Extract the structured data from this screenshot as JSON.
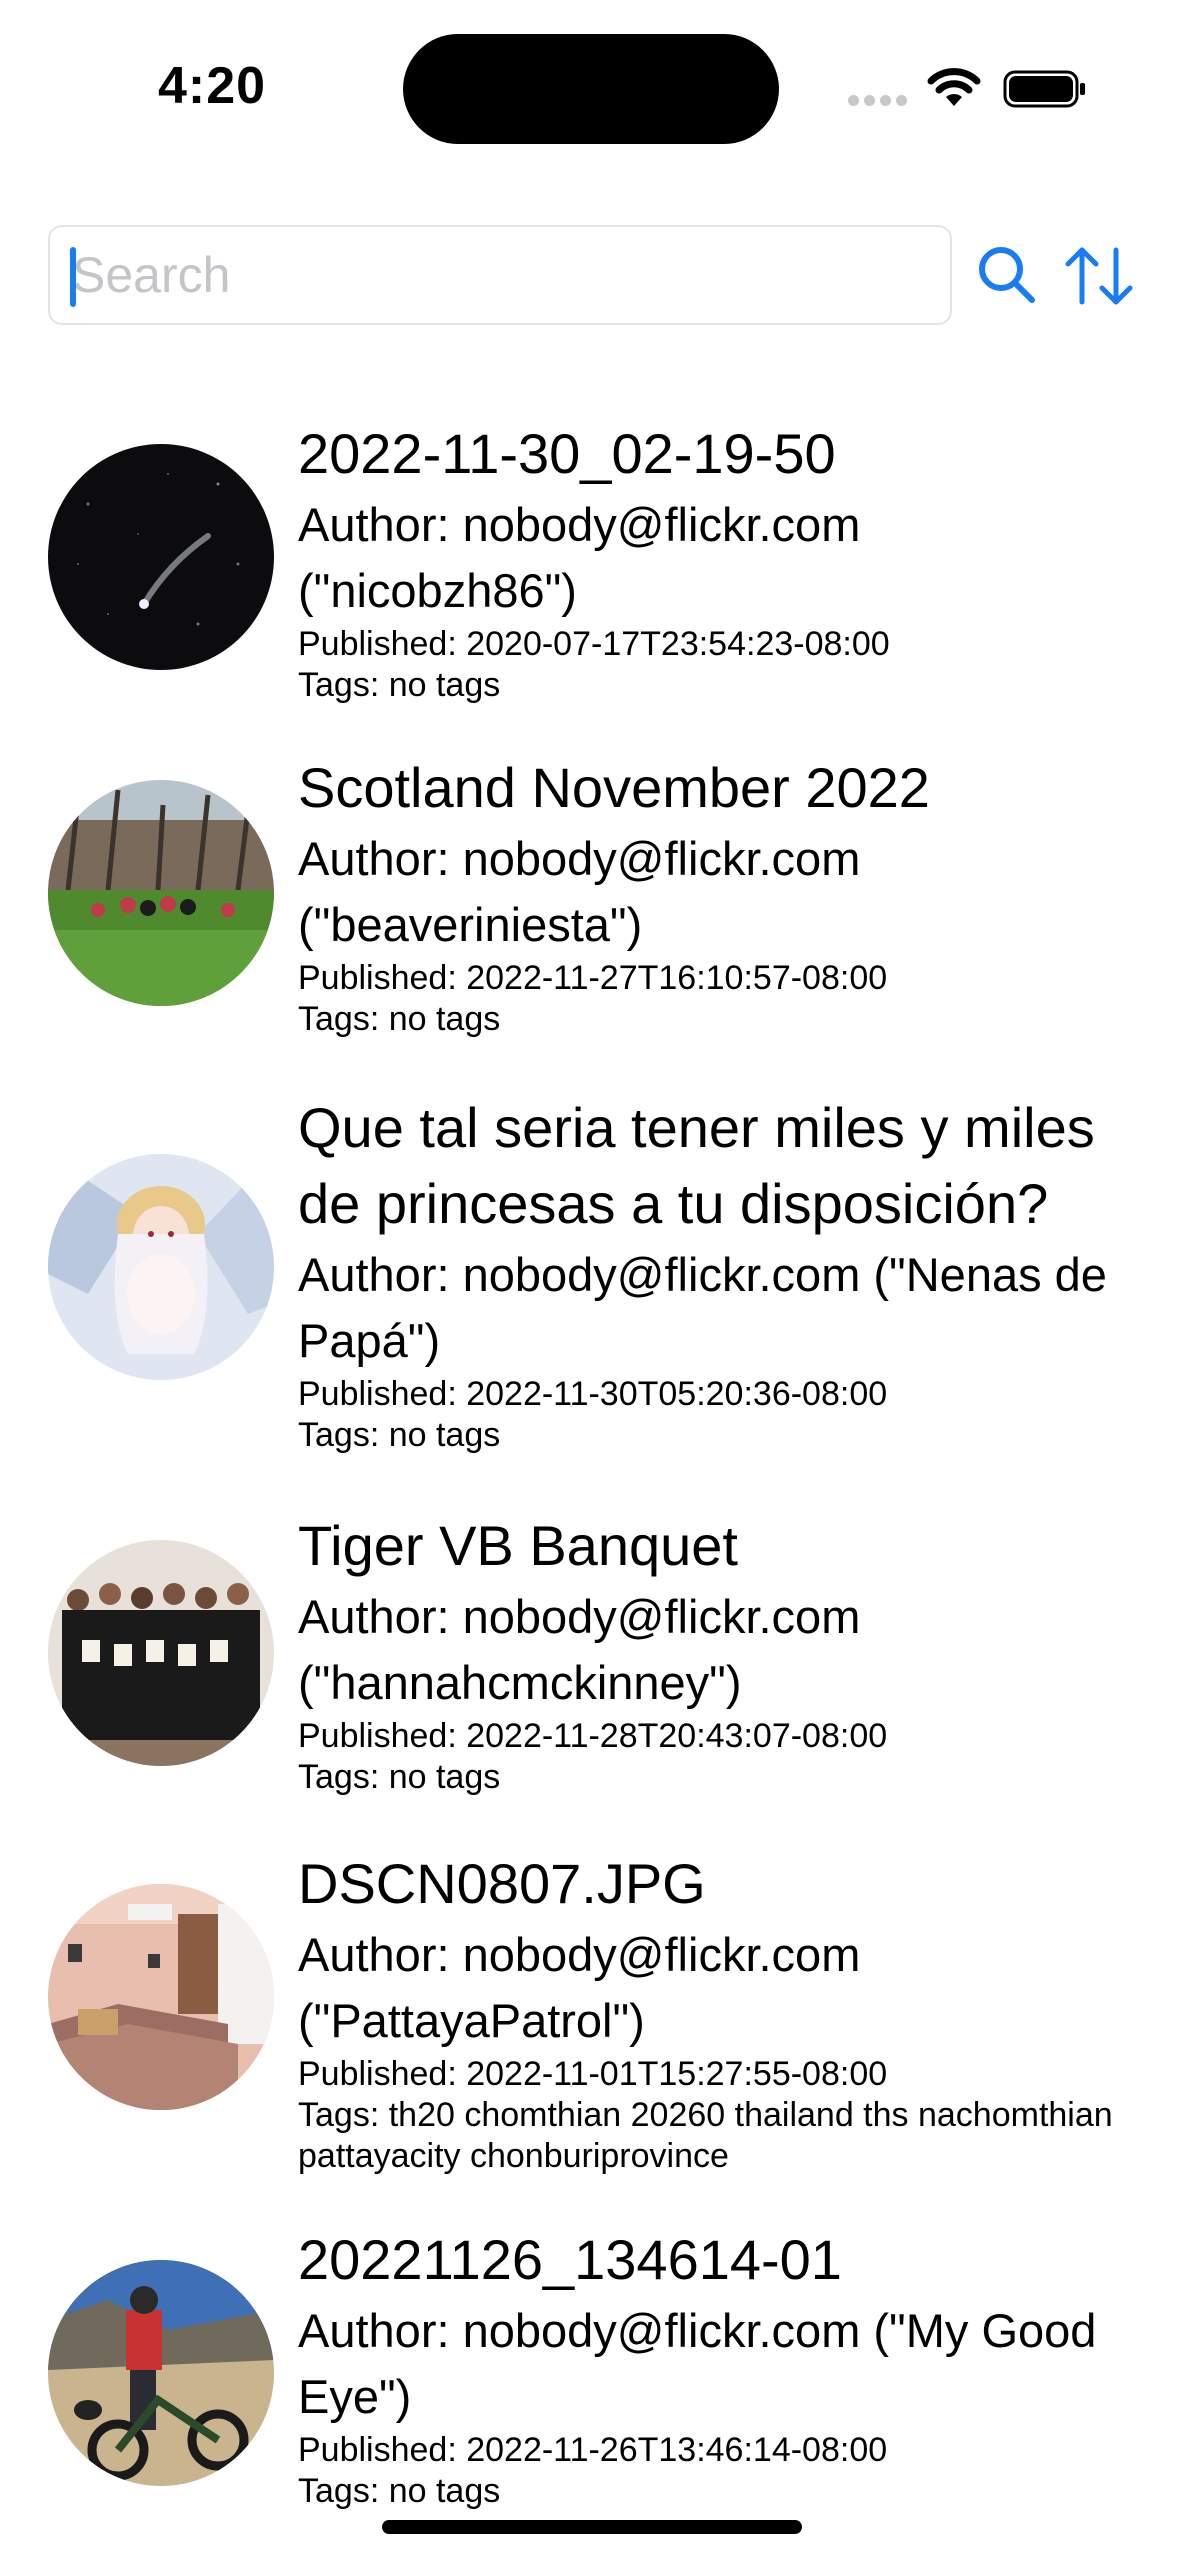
{
  "status_bar": {
    "time": "4:20"
  },
  "search": {
    "placeholder": "Search",
    "value": ""
  },
  "toolbar": {
    "search_icon": "magnifying-glass",
    "sort_icon": "arrow-up-arrow-down",
    "accent": "#1a7cf5"
  },
  "photos": [
    {
      "title": "2022-11-30_02-19-50",
      "author": "Author: nobody@flickr.com (\"nicobzh86\")",
      "published": "Published: 2020-07-17T23:54:23-08:00",
      "tags": "Tags: no tags"
    },
    {
      "title": "Scotland November 2022",
      "author": "Author: nobody@flickr.com (\"beaveriniesta\")",
      "published": "Published: 2022-11-27T16:10:57-08:00",
      "tags": "Tags: no tags"
    },
    {
      "title": "Que tal seria tener miles y miles de princesas a tu disposición?",
      "author": "Author: nobody@flickr.com (\"Nenas de Papá\")",
      "published": "Published: 2022-11-30T05:20:36-08:00",
      "tags": "Tags: no tags"
    },
    {
      "title": "Tiger VB Banquet",
      "author": "Author: nobody@flickr.com (\"hannahcmckinney\")",
      "published": "Published: 2022-11-28T20:43:07-08:00",
      "tags": "Tags: no tags"
    },
    {
      "title": "DSCN0807.JPG",
      "author": "Author: nobody@flickr.com (\"PattayaPatrol\")",
      "published": "Published: 2022-11-01T15:27:55-08:00",
      "tags": "Tags: th20 chomthian 20260 thailand ths nachomthian pattayacity chonburiprovince"
    },
    {
      "title": "20221126_134614-01",
      "author": "Author: nobody@flickr.com (\"My Good Eye\")",
      "published": "Published: 2022-11-26T13:46:14-08:00",
      "tags": "Tags: no tags"
    }
  ]
}
